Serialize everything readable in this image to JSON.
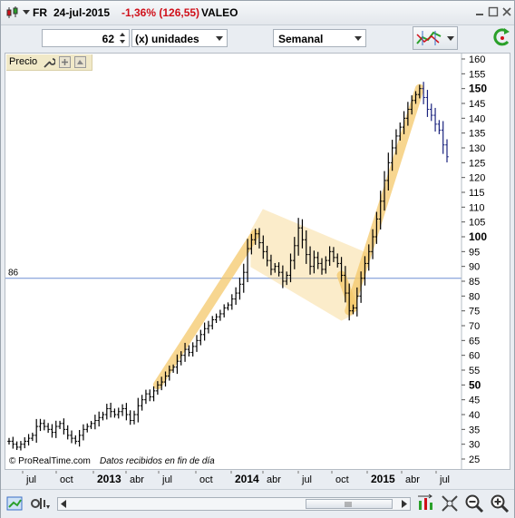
{
  "title": {
    "exchange": "FR",
    "date": "24-jul-2015",
    "change": "-1,36% (126,55)",
    "symbol": "VALEO"
  },
  "toolbar": {
    "quantity": "62",
    "unit_select": "(x) unidades",
    "period_select": "Semanal"
  },
  "panel": {
    "label": "Precio",
    "footer": "© ProRealTime.com",
    "footer_note": "Datos recibidos en fin de día",
    "hline_label": "86"
  },
  "chart_data": {
    "type": "ohlc",
    "y_ticks": [
      "25",
      "30",
      "35",
      "40",
      "45",
      "50",
      "55",
      "60",
      "65",
      "70",
      "75",
      "80",
      "85",
      "90",
      "95",
      "100",
      "105",
      "110",
      "115",
      "120",
      "125",
      "130",
      "135",
      "140",
      "145",
      "150",
      "155",
      "160"
    ],
    "bold_ticks": [
      "50",
      "100",
      "150"
    ],
    "ylim": [
      25,
      160
    ],
    "x_ticks": [
      "jul",
      "oct",
      "2013",
      "abr",
      "jul",
      "oct",
      "2014",
      "abr",
      "jul",
      "oct",
      "2015",
      "abr",
      "jul"
    ],
    "bold_x_ticks": [
      "2013",
      "2014",
      "2015"
    ],
    "horizontal_line": 86,
    "series": [
      {
        "values": [
          31,
          30,
          29,
          30,
          31,
          32,
          33,
          36,
          37,
          36,
          35,
          34,
          36,
          37,
          35,
          33,
          32,
          31,
          33,
          35,
          36,
          37,
          38,
          39,
          40,
          42,
          41,
          40,
          41,
          42,
          40,
          38,
          40,
          43,
          45,
          47,
          46,
          48,
          50,
          51,
          53,
          55,
          56,
          58,
          60,
          62,
          61,
          63,
          65,
          67,
          69,
          70,
          72,
          73,
          74,
          76,
          77,
          79,
          81,
          84,
          88,
          96,
          99,
          101,
          98,
          95,
          92,
          89,
          90,
          88,
          85,
          87,
          92,
          97,
          103,
          99,
          94,
          90,
          93,
          91,
          89,
          92,
          95,
          93,
          91,
          87,
          81,
          75,
          76,
          80,
          86,
          91,
          95,
          100,
          106,
          112,
          119,
          125,
          130,
          134,
          137,
          140,
          143,
          146,
          148,
          150,
          147,
          143,
          141,
          138,
          136,
          131,
          127
        ]
      }
    ],
    "highlight_color": "#f5c96b"
  }
}
